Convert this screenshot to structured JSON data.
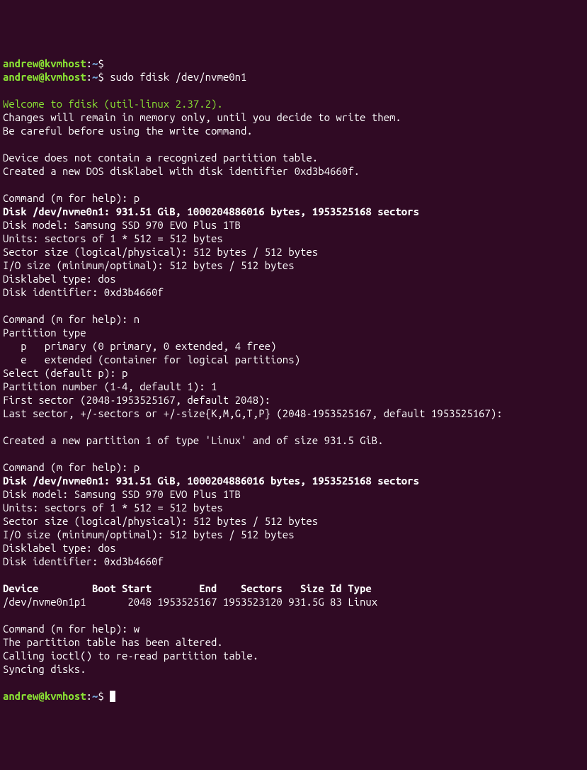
{
  "prompt": {
    "user": "andrew",
    "at": "@",
    "host": "kvmhost",
    "colon": ":",
    "path": "~",
    "dollar": "$"
  },
  "cmd1": "sudo fdisk /dev/nvme0n1",
  "welcome": "Welcome to fdisk (util-linux 2.37.2).",
  "intro1": "Changes will remain in memory only, until you decide to write them.",
  "intro2": "Be careful before using the write command.",
  "warn1": "Device does not contain a recognized partition table.",
  "warn2": "Created a new DOS disklabel with disk identifier 0xd3b4660f.",
  "cmdhelp1": "Command (m for help): p",
  "disk_header": "Disk /dev/nvme0n1: 931.51 GiB, 1000204886016 bytes, 1953525168 sectors",
  "disk_model": "Disk model: Samsung SSD 970 EVO Plus 1TB",
  "units": "Units: sectors of 1 * 512 = 512 bytes",
  "sector_size": "Sector size (logical/physical): 512 bytes / 512 bytes",
  "io_size": "I/O size (minimum/optimal): 512 bytes / 512 bytes",
  "disklabel": "Disklabel type: dos",
  "diskid": "Disk identifier: 0xd3b4660f",
  "cmdhelp2": "Command (m for help): n",
  "ptype_hdr": "Partition type",
  "ptype_p": "   p   primary (0 primary, 0 extended, 4 free)",
  "ptype_e": "   e   extended (container for logical partitions)",
  "select_p": "Select (default p): p",
  "pnum": "Partition number (1-4, default 1): 1",
  "first_sector": "First sector (2048-1953525167, default 2048):",
  "last_sector": "Last sector, +/-sectors or +/-size{K,M,G,T,P} (2048-1953525167, default 1953525167):",
  "created": "Created a new partition 1 of type 'Linux' and of size 931.5 GiB.",
  "cmdhelp3": "Command (m for help): p",
  "table_hdr": "Device         Boot Start        End    Sectors   Size Id Type",
  "table_row": "/dev/nvme0n1p1       2048 1953525167 1953523120 931.5G 83 Linux",
  "cmdhelp4": "Command (m for help): w",
  "altered": "The partition table has been altered.",
  "ioctl": "Calling ioctl() to re-read partition table.",
  "syncing": "Syncing disks."
}
